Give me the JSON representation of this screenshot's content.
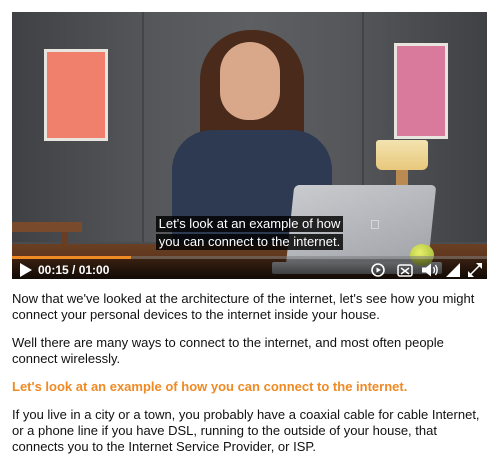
{
  "video": {
    "caption_lines": [
      "Let's look at an example of how",
      "you can connect to the internet."
    ],
    "time_display": "00:15 / 01:00",
    "progress_fraction": 0.25,
    "accent_color": "#f08a24",
    "icons": {
      "play": "play-icon",
      "closed_captions": "closed-captions-icon",
      "subtitles": "subtitles-icon",
      "volume": "volume-icon",
      "quality": "quality-icon",
      "fullscreen": "fullscreen-icon"
    }
  },
  "article": {
    "paragraphs": [
      "Now that we've looked at the architecture of the internet, let's see how you might connect your personal devices to the internet inside your house.",
      "Well there are many ways to connect to the internet, and most often people connect wirelessly.",
      "Let's look at an example of how you can connect to the internet.",
      "If you live in a city or a town, you probably have a coaxial cable for cable Internet, or a phone line if you have DSL, running to the outside of your house, that connects you to the Internet Service Provider, or ISP."
    ]
  }
}
